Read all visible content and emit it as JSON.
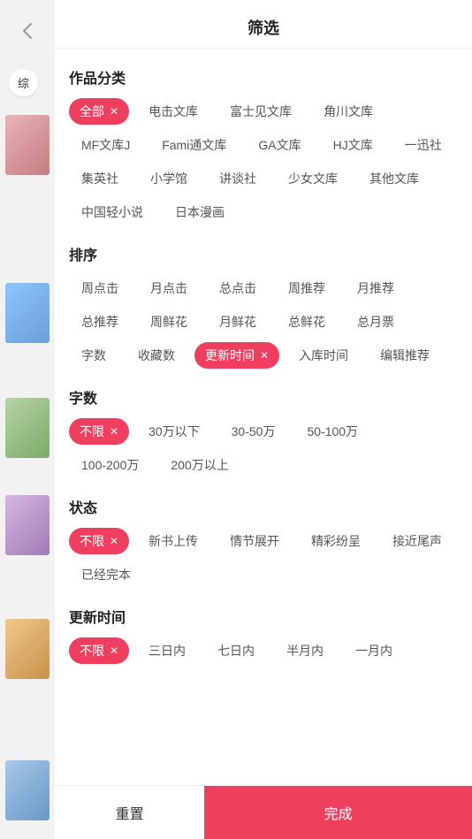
{
  "header": {
    "title": "筛选",
    "back_icon": "‹"
  },
  "left_panel": {
    "tab_label": "综"
  },
  "sections": {
    "category": {
      "title": "作品分类",
      "tags": [
        {
          "label": "全部",
          "active": true
        },
        {
          "label": "电击文库",
          "active": false
        },
        {
          "label": "富士见文库",
          "active": false
        },
        {
          "label": "角川文库",
          "active": false
        },
        {
          "label": "MF文库J",
          "active": false
        },
        {
          "label": "Fami通文库",
          "active": false
        },
        {
          "label": "GA文库",
          "active": false
        },
        {
          "label": "HJ文库",
          "active": false
        },
        {
          "label": "一迅社",
          "active": false
        },
        {
          "label": "集英社",
          "active": false
        },
        {
          "label": "小学馆",
          "active": false
        },
        {
          "label": "讲谈社",
          "active": false
        },
        {
          "label": "少女文库",
          "active": false
        },
        {
          "label": "其他文库",
          "active": false
        },
        {
          "label": "中国轻小说",
          "active": false
        },
        {
          "label": "日本漫画",
          "active": false
        }
      ]
    },
    "sort": {
      "title": "排序",
      "tags": [
        {
          "label": "周点击",
          "active": false
        },
        {
          "label": "月点击",
          "active": false
        },
        {
          "label": "总点击",
          "active": false
        },
        {
          "label": "周推荐",
          "active": false
        },
        {
          "label": "月推荐",
          "active": false
        },
        {
          "label": "总推荐",
          "active": false
        },
        {
          "label": "周鲜花",
          "active": false
        },
        {
          "label": "月鲜花",
          "active": false
        },
        {
          "label": "总鲜花",
          "active": false
        },
        {
          "label": "总月票",
          "active": false
        },
        {
          "label": "字数",
          "active": false
        },
        {
          "label": "收藏数",
          "active": false
        },
        {
          "label": "更新时间",
          "active": true
        },
        {
          "label": "入库时间",
          "active": false
        },
        {
          "label": "编辑推荐",
          "active": false
        }
      ]
    },
    "word_count": {
      "title": "字数",
      "tags": [
        {
          "label": "不限",
          "active": true
        },
        {
          "label": "30万以下",
          "active": false
        },
        {
          "label": "30-50万",
          "active": false
        },
        {
          "label": "50-100万",
          "active": false
        },
        {
          "label": "100-200万",
          "active": false
        },
        {
          "label": "200万以上",
          "active": false
        }
      ]
    },
    "status": {
      "title": "状态",
      "tags": [
        {
          "label": "不限",
          "active": true
        },
        {
          "label": "新书上传",
          "active": false
        },
        {
          "label": "情节展开",
          "active": false
        },
        {
          "label": "精彩纷呈",
          "active": false
        },
        {
          "label": "接近尾声",
          "active": false
        },
        {
          "label": "已经完本",
          "active": false
        }
      ]
    },
    "update_time": {
      "title": "更新时间",
      "tags": [
        {
          "label": "不限",
          "active": true
        },
        {
          "label": "三日内",
          "active": false
        },
        {
          "label": "七日内",
          "active": false
        },
        {
          "label": "半月内",
          "active": false
        },
        {
          "label": "一月内",
          "active": false
        }
      ]
    }
  },
  "footer": {
    "reset_label": "重置",
    "confirm_label": "完成"
  },
  "colors": {
    "accent": "#f03e5f"
  }
}
